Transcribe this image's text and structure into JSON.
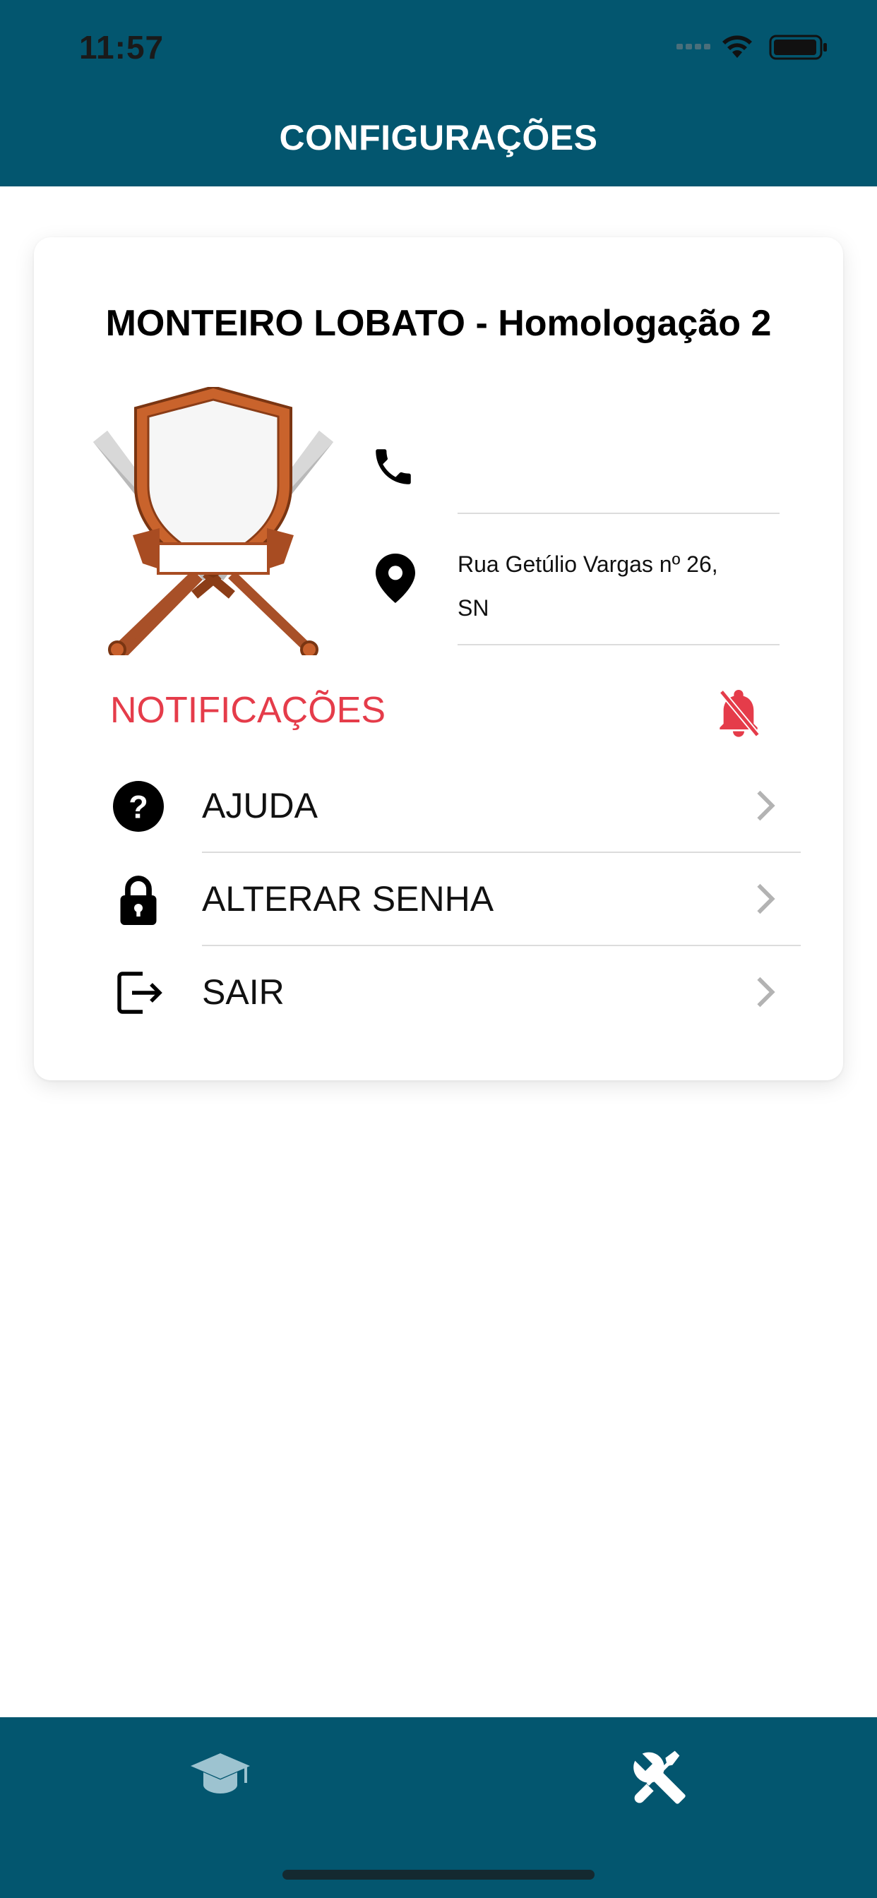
{
  "status_bar": {
    "time": "11:57"
  },
  "header": {
    "title": "CONFIGURAÇÕES"
  },
  "card": {
    "school_name": "MONTEIRO LOBATO - Homologação 2",
    "phone": "",
    "address_line1": "Rua Getúlio Vargas nº 26,",
    "address_line2": "SN",
    "notifications_label": "NOTIFICAÇÕES",
    "menu": [
      {
        "label": "AJUDA",
        "icon": "help-circle-icon"
      },
      {
        "label": "ALTERAR SENHA",
        "icon": "lock-icon"
      },
      {
        "label": "SAIR",
        "icon": "logout-icon"
      }
    ]
  },
  "tabbar": {
    "tabs": [
      {
        "icon": "graduation-cap-icon",
        "active": false
      },
      {
        "icon": "tools-icon",
        "active": true
      }
    ]
  },
  "colors": {
    "primary": "#03566f",
    "notification_red": "#e53c4a",
    "chevron": "#b3b3b3"
  }
}
